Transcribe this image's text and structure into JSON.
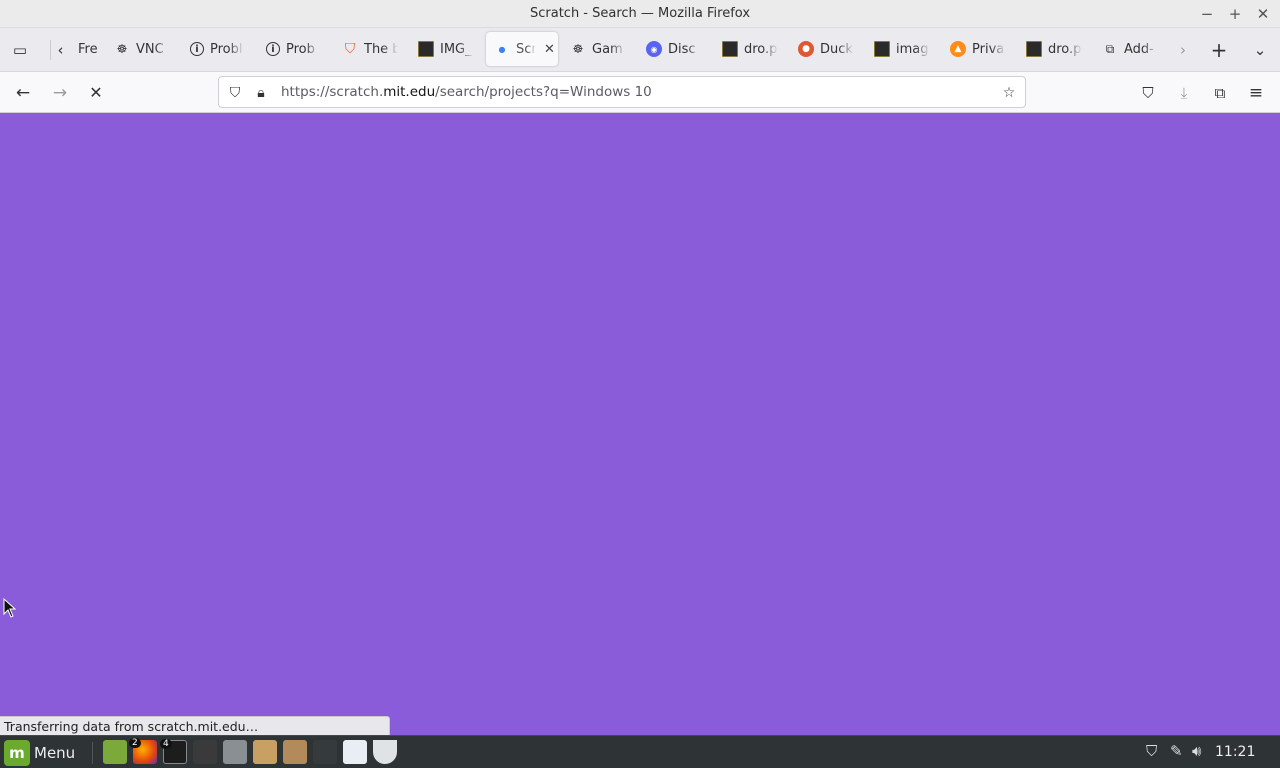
{
  "window": {
    "title": "Scratch - Search — Mozilla Firefox",
    "controls": {
      "minimize": "−",
      "maximize": "+",
      "close": "✕"
    }
  },
  "tabs": [
    {
      "label": "Fre",
      "icon": "left-arrow-icon",
      "active": false
    },
    {
      "label": "VNC",
      "icon": "vnc-icon",
      "active": false
    },
    {
      "label": "Probl",
      "icon": "info-icon",
      "active": false
    },
    {
      "label": "Prob",
      "icon": "info-icon",
      "active": false
    },
    {
      "label": "The b",
      "icon": "brave-icon",
      "active": false
    },
    {
      "label": "IMG_",
      "icon": "image-icon",
      "active": false
    },
    {
      "label": "Scr",
      "icon": "loading-dot-icon",
      "active": true
    },
    {
      "label": "Gam",
      "icon": "vnc-icon",
      "active": false
    },
    {
      "label": "Disc",
      "icon": "discord-icon",
      "active": false
    },
    {
      "label": "dro.p",
      "icon": "image-icon",
      "active": false
    },
    {
      "label": "Duck",
      "icon": "duckduckgo-icon",
      "active": false
    },
    {
      "label": "imag",
      "icon": "image-icon",
      "active": false
    },
    {
      "label": "Priva",
      "icon": "privacy-icon",
      "active": false
    },
    {
      "label": "dro.p",
      "icon": "image-icon",
      "active": false
    },
    {
      "label": "Add-",
      "icon": "puzzle-icon",
      "active": false
    }
  ],
  "navbar": {
    "url_prefix": "https://scratch.",
    "url_host": "mit.edu",
    "url_path": "/search/projects?q=Windows 10"
  },
  "status_text": "Transferring data from scratch.mit.edu…",
  "taskbar": {
    "menu_label": "Menu",
    "firefox_badge": "2",
    "terminal_badge": "4",
    "clock": "11:21"
  },
  "colors": {
    "page_background": "#8a5cd9",
    "taskbar": "#2e3436"
  }
}
